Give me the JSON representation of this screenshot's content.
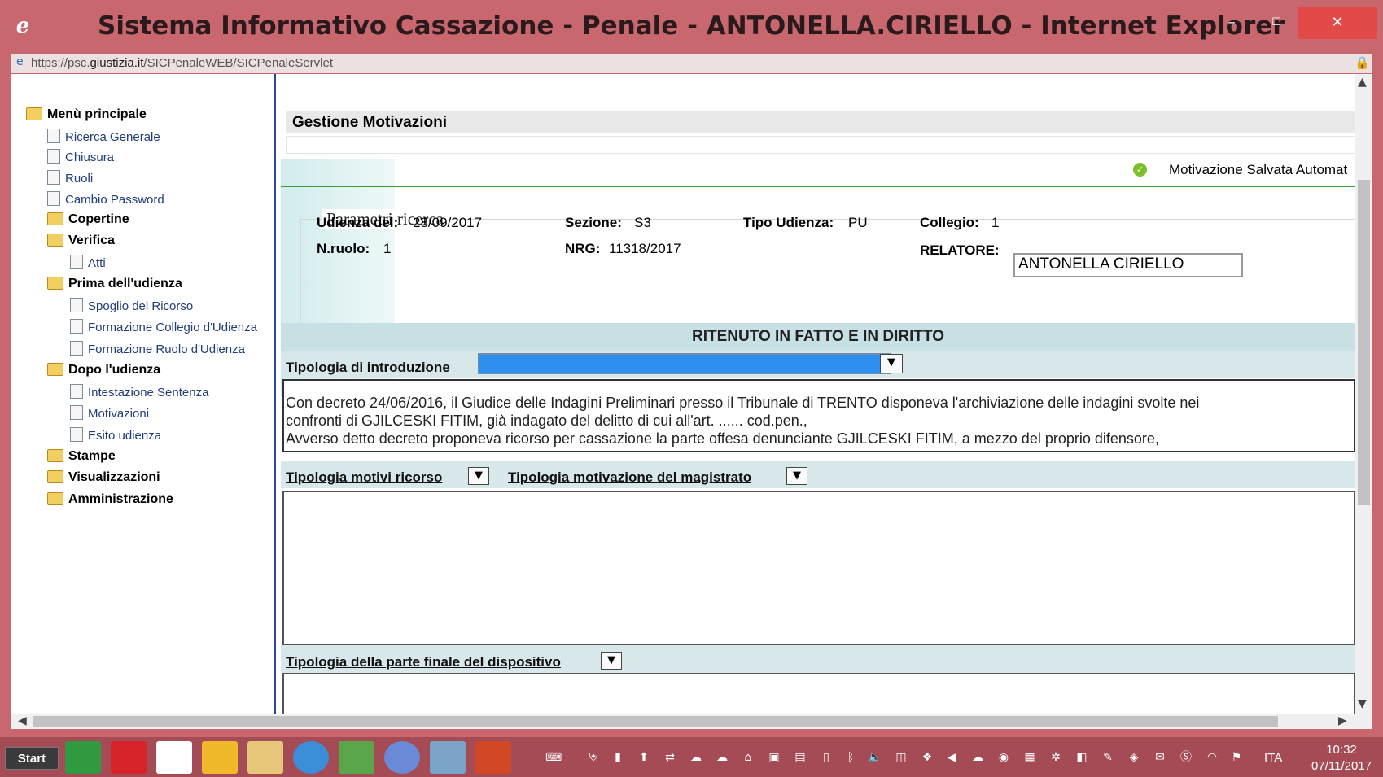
{
  "window": {
    "title": "Sistema Informativo Cassazione - Penale - ANTONELLA.CIRIELLO - Internet Explorer",
    "minimize": "–",
    "maximize": "☐",
    "close": "✕"
  },
  "address": {
    "prefix": "https://psc.",
    "domain": "giustizia.it",
    "path": "/SICPenaleWEB/SICPenaleServlet"
  },
  "sidebar": {
    "root": "Menù principale",
    "items": [
      {
        "label": "Ricerca Generale"
      },
      {
        "label": "Chiusura"
      },
      {
        "label": "Ruoli"
      },
      {
        "label": "Cambio Password"
      },
      {
        "label": "Copertine"
      },
      {
        "label": "Verifica"
      },
      {
        "label": "Atti"
      },
      {
        "label": "Prima dell'udienza"
      },
      {
        "label": "Spoglio del Ricorso"
      },
      {
        "label": "Formazione Collegio d'Udienza"
      },
      {
        "label": "Formazione Ruolo d'Udienza"
      },
      {
        "label": "Dopo l'udienza"
      },
      {
        "label": "Intestazione Sentenza"
      },
      {
        "label": "Motivazioni"
      },
      {
        "label": "Esito udienza"
      },
      {
        "label": "Stampe"
      },
      {
        "label": "Visualizzazioni"
      },
      {
        "label": "Amministrazione"
      }
    ]
  },
  "main": {
    "header": "Gestione Motivazioni",
    "status": "Motivazione Salvata Automat",
    "params": {
      "legend": "Parametri ricerca",
      "udienza_label": "Udienza del:",
      "udienza_value": "28/09/2017",
      "sezione_label": "Sezione:",
      "sezione_value": "S3",
      "tipo_label": "Tipo Udienza:",
      "tipo_value": "PU",
      "collegio_label": "Collegio:",
      "collegio_value": "1",
      "nruolo_label": "N.ruolo:",
      "nruolo_value": "1",
      "nrg_label": "NRG:",
      "nrg_value": "11318/2017",
      "relatore_label": "RELATORE:",
      "relatore_value": "ANTONELLA CIRIELLO"
    },
    "section_title": "RITENUTO IN FATTO E IN DIRITTO",
    "intro_label": "Tipologia di introduzione",
    "intro_text_1": "Con decreto 24/06/2016, il Giudice delle Indagini Preliminari presso il Tribunale di TRENTO disponeva l'archiviazione delle indagini svolte nei",
    "intro_text_2": "confronti di GJILCESKI FITIM, già indagato del delitto di cui all'art. ...... cod.pen.,",
    "intro_text_3": "Avverso detto decreto  proponeva ricorso per cassazione la parte offesa denunciante GJILCESKI FITIM, a mezzo del proprio difensore,",
    "motivi_label": "Tipologia motivi ricorso",
    "magistrato_label": "Tipologia motivazione del magistrato",
    "finale_label": "Tipologia della parte finale del dispositivo"
  },
  "taskbar": {
    "start": "Start",
    "language": "ITA",
    "time": "10:32",
    "date": "07/11/2017"
  },
  "colors": {
    "titlebar": "#c9676f",
    "close_button": "#e24a4a",
    "taskbar": "#a44b55",
    "section_bar": "#c7e0e3",
    "selected_dropdown": "#2f8ff0",
    "status_ok": "#7bbf2a"
  }
}
